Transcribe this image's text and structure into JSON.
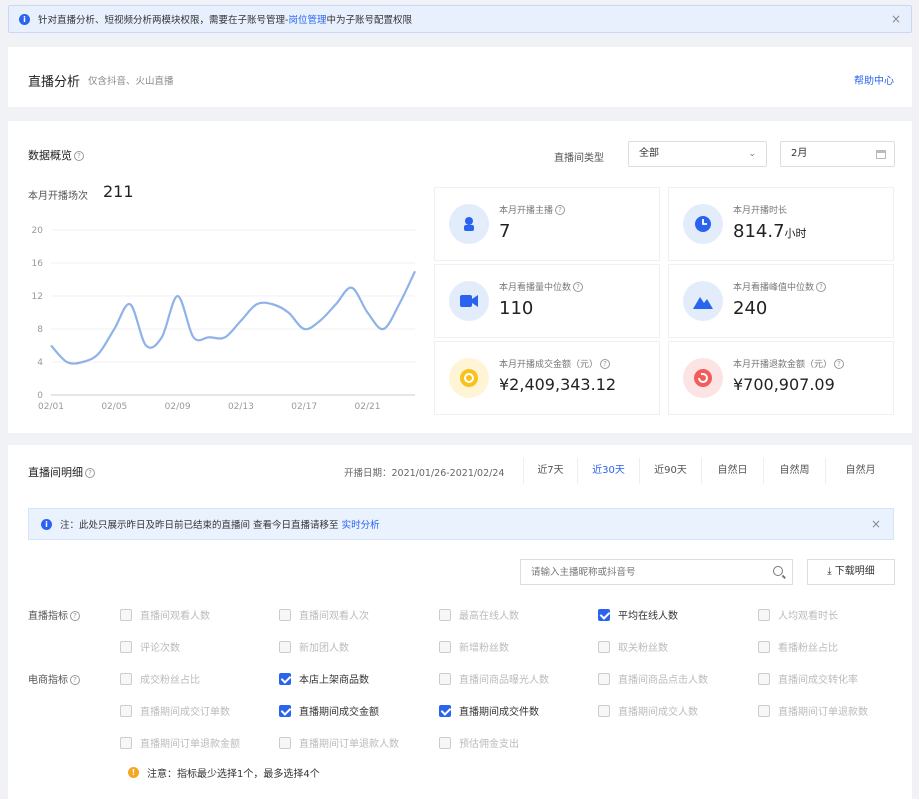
{
  "alert": {
    "text": "针对直播分析、短视频分析两模块权限，需要在子账号管理-",
    "link": "岗位管理",
    "tail": "中为子账号配置权限",
    "close": "×"
  },
  "header": {
    "title": "直播分析",
    "subtitle": "仅含抖音、火山直播",
    "help": "帮助中心"
  },
  "overview": {
    "title": "数据概览",
    "room_type_label": "直播间类型",
    "room_type_value": "全部",
    "month_value": "2月",
    "total_label": "本月开播场次",
    "total_value": "211",
    "stats": [
      {
        "label": "本月开播主播",
        "value": "7",
        "unit": ""
      },
      {
        "label": "本月开播时长",
        "value": "814.7",
        "unit": "小时"
      },
      {
        "label": "本月看播量中位数",
        "value": "110",
        "unit": ""
      },
      {
        "label": "本月看播峰值中位数",
        "value": "240",
        "unit": ""
      },
      {
        "label": "本月开播成交金额（元）",
        "value": "¥2,409,343.12",
        "unit": ""
      },
      {
        "label": "本月开播退款金额（元）",
        "value": "¥700,907.09",
        "unit": ""
      }
    ]
  },
  "chart_data": {
    "type": "line",
    "x": [
      "02/01",
      "02/02",
      "02/03",
      "02/04",
      "02/05",
      "02/06",
      "02/07",
      "02/08",
      "02/09",
      "02/10",
      "02/11",
      "02/12",
      "02/13",
      "02/14",
      "02/15",
      "02/16",
      "02/17",
      "02/18",
      "02/19",
      "02/20",
      "02/21",
      "02/22",
      "02/23",
      "02/24"
    ],
    "x_ticks": [
      "02/01",
      "02/05",
      "02/09",
      "02/13",
      "02/17",
      "02/21"
    ],
    "values": [
      6,
      4,
      4,
      5,
      8,
      11,
      6,
      7,
      12,
      7,
      7,
      7,
      9,
      11,
      11,
      10,
      8,
      9,
      11,
      13,
      10,
      8,
      11,
      15
    ],
    "ylim": [
      0,
      20
    ],
    "y_ticks": [
      0,
      4,
      8,
      12,
      16,
      20
    ],
    "color": "#8fb3e8"
  },
  "detail": {
    "title": "直播间明细",
    "date_label": "开播日期：2021/01/26-2021/02/24",
    "ranges": [
      "近7天",
      "近30天",
      "近90天",
      "自然日",
      "自然周",
      "自然月"
    ],
    "active_range": "近30天",
    "notice": "注：此处只展示昨日及昨日前已结束的直播间 查看今日直播请移至",
    "notice_link": "实时分析",
    "notice_close": "×",
    "search_placeholder": "请输入主播昵称或抖音号",
    "download": "下载明细",
    "group1_label": "直播指标",
    "group2_label": "电商指标",
    "metrics_row1": [
      {
        "label": "直播间观看人数",
        "checked": false
      },
      {
        "label": "直播间观看人次",
        "checked": false
      },
      {
        "label": "最高在线人数",
        "checked": false
      },
      {
        "label": "平均在线人数",
        "checked": true
      },
      {
        "label": "人均观看时长",
        "checked": false
      }
    ],
    "metrics_row2": [
      {
        "label": "评论次数",
        "checked": false
      },
      {
        "label": "新加团人数",
        "checked": false
      },
      {
        "label": "新增粉丝数",
        "checked": false
      },
      {
        "label": "取关粉丝数",
        "checked": false
      },
      {
        "label": "看播粉丝占比",
        "checked": false
      }
    ],
    "metrics_row3": [
      {
        "label": "成交粉丝占比",
        "checked": false
      },
      {
        "label": "本店上架商品数",
        "checked": true
      },
      {
        "label": "直播间商品曝光人数",
        "checked": false
      },
      {
        "label": "直播间商品点击人数",
        "checked": false
      },
      {
        "label": "直播间成交转化率",
        "checked": false
      }
    ],
    "metrics_row4": [
      {
        "label": "直播期间成交订单数",
        "checked": false
      },
      {
        "label": "直播期间成交金额",
        "checked": true
      },
      {
        "label": "直播期间成交件数",
        "checked": true
      },
      {
        "label": "直播期间成交人数",
        "checked": false
      },
      {
        "label": "直播期间订单退款数",
        "checked": false
      }
    ],
    "metrics_row5": [
      {
        "label": "直播期间订单退款金额",
        "checked": false
      },
      {
        "label": "直播期间订单退款人数",
        "checked": false
      },
      {
        "label": "预估佣金支出",
        "checked": false
      }
    ],
    "tip": "注意：指标最少选择1个，最多选择4个"
  }
}
